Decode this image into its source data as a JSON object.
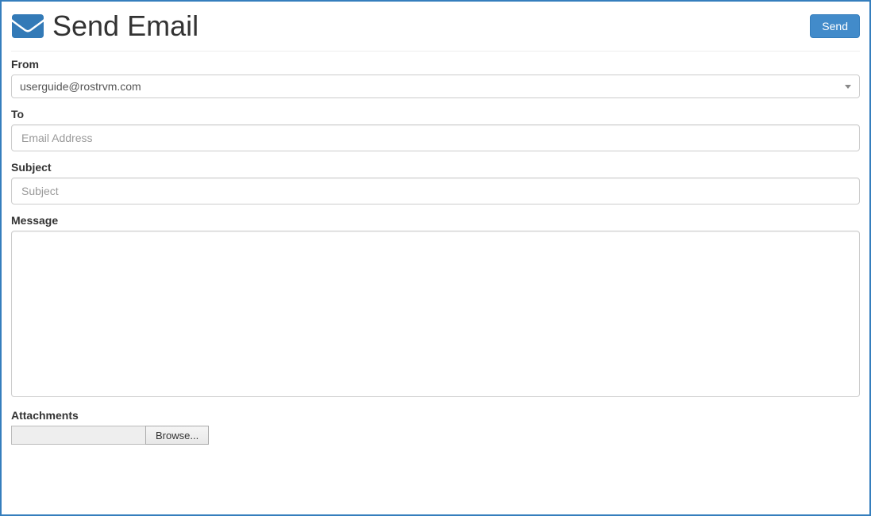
{
  "header": {
    "title": "Send Email",
    "send_button": "Send"
  },
  "form": {
    "from": {
      "label": "From",
      "selected": "userguide@rostrvm.com"
    },
    "to": {
      "label": "To",
      "placeholder": "Email Address",
      "value": ""
    },
    "subject": {
      "label": "Subject",
      "placeholder": "Subject",
      "value": ""
    },
    "message": {
      "label": "Message",
      "value": ""
    },
    "attachments": {
      "label": "Attachments",
      "browse_label": "Browse...",
      "path": ""
    }
  }
}
